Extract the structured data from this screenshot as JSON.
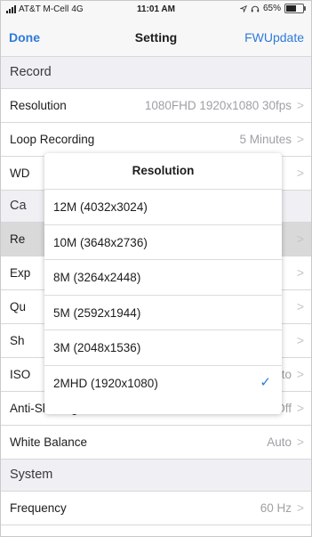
{
  "status": {
    "carrier": "AT&T M-Cell",
    "network": "4G",
    "time": "11:01 AM",
    "battery": "65%"
  },
  "nav": {
    "done": "Done",
    "title": "Setting",
    "fw_update": "FWUpdate"
  },
  "sections": {
    "record": "Record",
    "camera_partial": "Ca",
    "system": "System"
  },
  "rows": {
    "resolution": {
      "label": "Resolution",
      "value": "1080FHD 1920x1080 30fps"
    },
    "loop": {
      "label": "Loop Recording",
      "value": "5 Minutes"
    },
    "wdr": {
      "label": "WD"
    },
    "photo_res": {
      "label": "Re"
    },
    "exposure": {
      "label": "Exp"
    },
    "quality": {
      "label": "Qu"
    },
    "sharpness": {
      "label": "Sh"
    },
    "iso": {
      "label": "ISO",
      "value": "Auto"
    },
    "anti_shaking": {
      "label": "Anti-Shaking",
      "value": "Off"
    },
    "white_balance": {
      "label": "White Balance",
      "value": "Auto"
    },
    "frequency": {
      "label": "Frequency",
      "value": "60 Hz"
    }
  },
  "popup": {
    "title": "Resolution",
    "options": [
      "12M (4032x3024)",
      "10M (3648x2736)",
      "8M (3264x2448)",
      "5M (2592x1944)",
      "3M (2048x1536)",
      "2MHD (1920x1080)"
    ],
    "selected": "2MHD (1920x1080)"
  }
}
